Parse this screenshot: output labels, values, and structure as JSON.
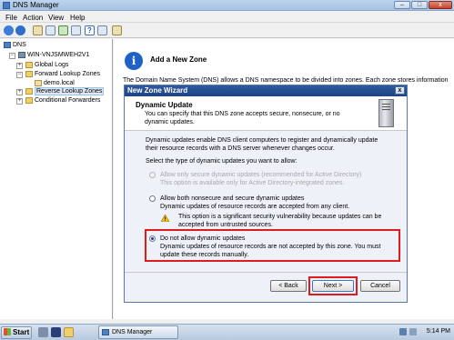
{
  "window": {
    "title": "DNS Manager",
    "controls": {
      "minimize": "–",
      "maximize": "□",
      "close": "x"
    }
  },
  "menu": [
    "File",
    "Action",
    "View",
    "Help"
  ],
  "toolbar": {
    "icons": [
      "back-arrow-icon",
      "forward-arrow-icon",
      "up-folder-icon",
      "console-tree-icon",
      "refresh-icon",
      "export-icon",
      "help-icon",
      "properties-icon",
      "server-icon"
    ]
  },
  "tree": {
    "root": "DNS",
    "server": "WIN-VNJSMWEH2V1",
    "items": [
      {
        "label": "Global Logs"
      },
      {
        "label": "Forward Lookup Zones"
      },
      {
        "label": "demo.local"
      },
      {
        "label": "Reverse Lookup Zones"
      },
      {
        "label": "Conditional Forwarders"
      }
    ]
  },
  "background_pane": {
    "heading": "Add a New Zone",
    "description": "The Domain Name System (DNS) allows a DNS namespace to be divided into zones. Each zone stores information"
  },
  "wizard": {
    "title": "New Zone Wizard",
    "close_label": "x",
    "header_title": "Dynamic Update",
    "header_subtitle": "You can specify that this DNS zone accepts secure, nonsecure, or no dynamic updates.",
    "intro": "Dynamic updates enable DNS client computers to register and dynamically update their resource records with a DNS server whenever changes occur.",
    "prompt": "Select the type of dynamic updates you want to allow:",
    "options": [
      {
        "label": "Allow only secure dynamic updates (recommended for Active Directory)",
        "description": "This option is available only for Active Directory-integrated zones.",
        "checked": false,
        "disabled": true
      },
      {
        "label": "Allow both nonsecure and secure dynamic updates",
        "description": "Dynamic updates of resource records are accepted from any client.",
        "warning": "This option is a significant security vulnerability because updates can be accepted from untrusted sources.",
        "checked": false,
        "disabled": false
      },
      {
        "label": "Do not allow dynamic updates",
        "description": "Dynamic updates of resource records are not accepted by this zone. You must update these records manually.",
        "checked": true,
        "disabled": false
      }
    ],
    "buttons": {
      "back": "< Back",
      "next": "Next >",
      "cancel": "Cancel"
    }
  },
  "taskbar": {
    "start_label": "Start",
    "task_label": "DNS Manager",
    "clock": "5:14 PM"
  },
  "colors": {
    "highlight": "#e01b1b",
    "wizard_titlebar": "#2e5a9e",
    "selection": "#dde8f6"
  }
}
